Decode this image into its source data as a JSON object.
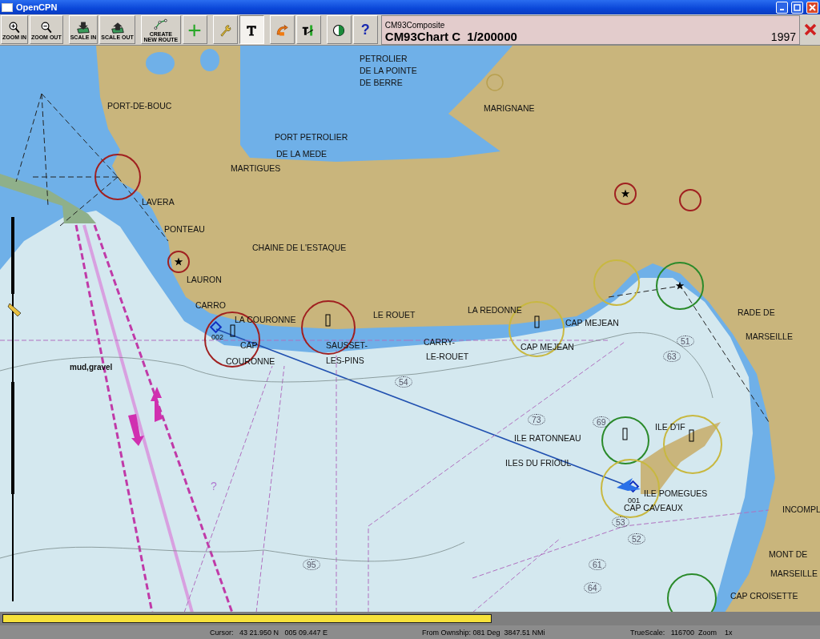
{
  "window": {
    "title": "OpenCPN"
  },
  "toolbar": {
    "buttons": [
      {
        "kind": "zoom_in",
        "label": "ZOOM IN",
        "pressed": false
      },
      {
        "kind": "zoom_out",
        "label": "ZOOM OUT",
        "pressed": false
      },
      {
        "kind": "scale_in",
        "label": "SCALE IN",
        "pressed": false
      },
      {
        "kind": "scale_out",
        "label": "SCALE OUT",
        "pressed": false
      },
      {
        "kind": "route",
        "label": "CREATE NEW ROUTE",
        "pressed": false
      },
      {
        "kind": "add",
        "pressed": false
      },
      {
        "kind": "settings",
        "pressed": false
      },
      {
        "kind": "text",
        "pressed": true
      },
      {
        "kind": "follow",
        "pressed": false
      },
      {
        "kind": "tide",
        "pressed": false
      },
      {
        "kind": "color",
        "pressed": false
      },
      {
        "kind": "help",
        "symbol": "?",
        "pressed": false
      }
    ]
  },
  "chart_info": {
    "source": "CM93Composite",
    "chart": "CM93Chart C  1/200000",
    "edition": "1997"
  },
  "map": {
    "labels": [
      {
        "kind": "place",
        "text": "PETROLIER"
      },
      {
        "kind": "place",
        "text": "DE LA POINTE"
      },
      {
        "kind": "place",
        "text": "DE BERRE"
      },
      {
        "kind": "place",
        "text": "MARIGNANE"
      },
      {
        "kind": "place",
        "text": "PORT-DE-BOUC"
      },
      {
        "kind": "place",
        "text": "PORT PETROLIER"
      },
      {
        "kind": "place",
        "text": "DE LA MEDE"
      },
      {
        "kind": "place",
        "text": "MARTIGUES"
      },
      {
        "kind": "place",
        "text": "LAVERA"
      },
      {
        "kind": "place",
        "text": "PONTEAU"
      },
      {
        "kind": "place",
        "text": "CHAINE DE L'ESTAQUE"
      },
      {
        "kind": "place",
        "text": "LAURON"
      },
      {
        "kind": "place",
        "text": "CARRO"
      },
      {
        "kind": "place",
        "text": "LA COURONNE"
      },
      {
        "kind": "place",
        "text": "LE ROUET"
      },
      {
        "kind": "place",
        "text": "LA REDONNE"
      },
      {
        "kind": "place",
        "text": "CAP MEJEAN"
      },
      {
        "kind": "place",
        "text": "RADE DE"
      },
      {
        "kind": "place",
        "text": "MARSEILLE"
      },
      {
        "kind": "waypoint",
        "text": "002"
      },
      {
        "kind": "place",
        "text": "CAP"
      },
      {
        "kind": "place",
        "text": "COURONNE"
      },
      {
        "kind": "place",
        "text": "SAUSSET-"
      },
      {
        "kind": "place",
        "text": "LES-PINS"
      },
      {
        "kind": "place",
        "text": "CARRY-"
      },
      {
        "kind": "place",
        "text": "LE-ROUET"
      },
      {
        "kind": "place",
        "text": "CAP MEJEAN"
      },
      {
        "kind": "note",
        "text": "mud,gravel"
      },
      {
        "kind": "sounding",
        "text": "54"
      },
      {
        "kind": "sounding",
        "text": "51"
      },
      {
        "kind": "sounding",
        "text": "63"
      },
      {
        "kind": "sounding",
        "text": "73"
      },
      {
        "kind": "sounding",
        "text": "69"
      },
      {
        "kind": "place",
        "text": "ILE D'IF"
      },
      {
        "kind": "place",
        "text": "ILE RATONNEAU"
      },
      {
        "kind": "place",
        "text": "ILES DU FRIOUL"
      },
      {
        "kind": "waypoint",
        "text": "001"
      },
      {
        "kind": "place",
        "text": "ILE POMEGUES"
      },
      {
        "kind": "place",
        "text": "CAP CAVEAUX"
      },
      {
        "kind": "place",
        "text": "INCOMPL"
      },
      {
        "kind": "sounding",
        "text": "53"
      },
      {
        "kind": "sounding",
        "text": "52"
      },
      {
        "kind": "mark",
        "text": "?"
      },
      {
        "kind": "sounding",
        "text": "95"
      },
      {
        "kind": "sounding",
        "text": "61"
      },
      {
        "kind": "sounding",
        "text": "64"
      },
      {
        "kind": "place",
        "text": "MONT DE"
      },
      {
        "kind": "place",
        "text": "MARSEILLE"
      },
      {
        "kind": "place",
        "text": "CAP CROISETTE"
      }
    ]
  },
  "status_bar": {
    "progress": {
      "level": 0.6
    },
    "cursor": "Cursor:   43 21.950 N   005 09.447 E",
    "ownship": "From Ownship: 081 Deg  3847.51 NMi",
    "scale": "TrueScale:   116700  Zoom    1x"
  }
}
